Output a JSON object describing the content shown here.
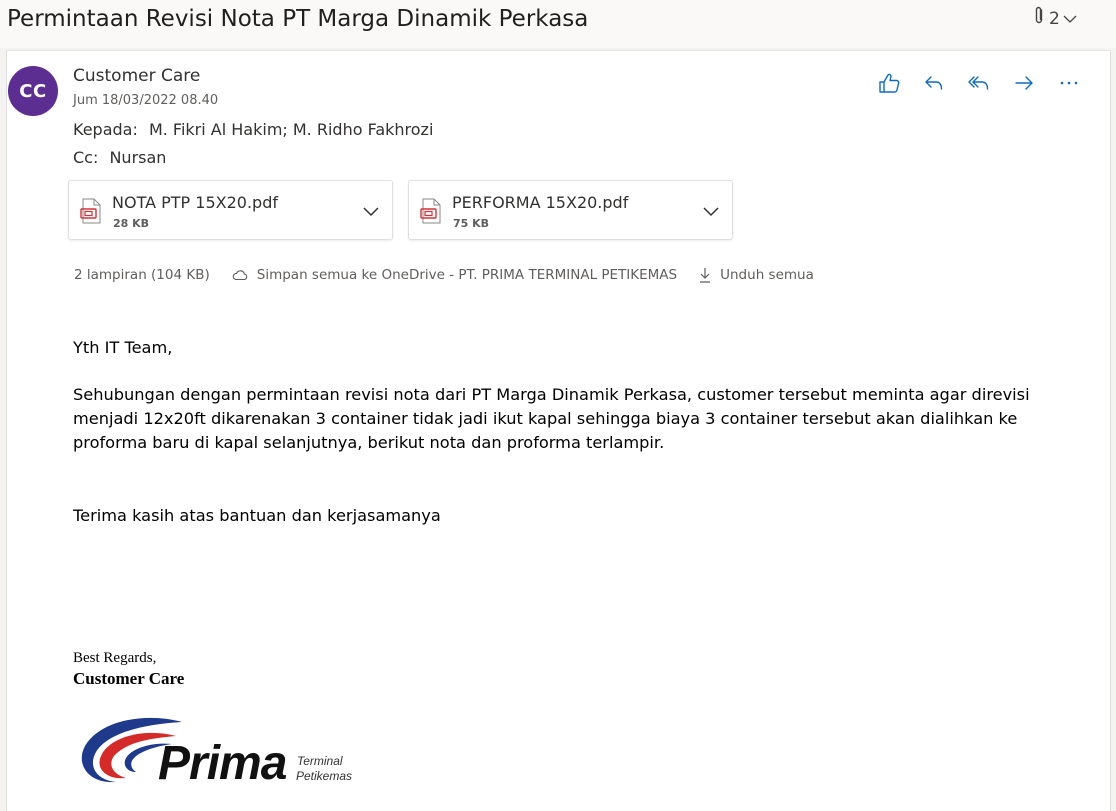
{
  "header": {
    "subject": "Permintaan Revisi Nota PT Marga Dinamik Perkasa",
    "attachment_count": "2"
  },
  "message": {
    "avatar_initials": "CC",
    "sender": "Customer Care",
    "date": "Jum 18/03/2022 08.40",
    "to_label": "Kepada:",
    "to": "M. Fikri Al Hakim; M. Ridho Fakhrozi",
    "cc_label": "Cc:",
    "cc": "Nursan"
  },
  "actions": {
    "icons": [
      "like-icon",
      "reply-icon",
      "reply-all-icon",
      "forward-icon",
      "more-icon"
    ]
  },
  "attachments": [
    {
      "name": "NOTA PTP 15X20.pdf",
      "size": "28 KB"
    },
    {
      "name": "PERFORMA 15X20.pdf",
      "size": "75 KB"
    }
  ],
  "attachment_bar": {
    "summary": "2 lampiran (104 KB)",
    "save_onedrive": "Simpan semua ke OneDrive - PT. PRIMA TERMINAL PETIKEMAS",
    "download_all": "Unduh semua"
  },
  "body": {
    "greeting": "Yth IT Team,",
    "paragraph": "Sehubungan dengan permintaan revisi nota dari PT Marga Dinamik Perkasa, customer tersebut meminta agar direvisi menjadi 12x20ft dikarenakan 3 container tidak jadi ikut kapal sehingga biaya 3 container tersebut akan dialihkan ke proforma baru di kapal selanjutnya, berikut nota dan proforma terlampir.",
    "thanks": "Terima kasih atas bantuan dan kerjasamanya",
    "regards": "Best Regards,",
    "signature_name": "Customer Care"
  },
  "logo": {
    "word": "Prima",
    "line1": "Terminal",
    "line2": "Petikemas"
  },
  "colors": {
    "accent": "#0f6cbd",
    "avatar_bg": "#5c2e91",
    "pdf_red": "#d13438",
    "logo_blue": "#1f3a8a",
    "logo_red": "#d42a2a"
  }
}
